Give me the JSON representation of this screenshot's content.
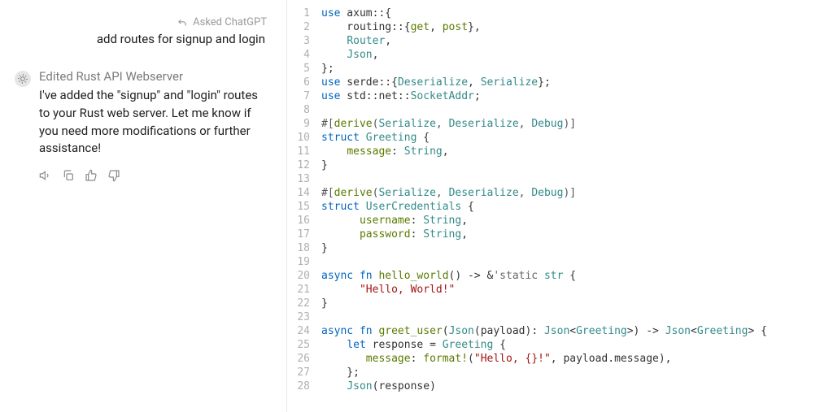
{
  "sidebar": {
    "asked_label": "Asked ChatGPT",
    "user_query": "add routes for signup and login",
    "response_title": "Edited Rust API Webserver",
    "response_body": "I've added the \"signup\" and \"login\" routes to your Rust web server. Let me know if you need more modifications or further assistance!"
  },
  "code": {
    "lines": [
      {
        "n": 1,
        "t": [
          [
            "kw",
            "use"
          ],
          [
            "pu",
            " axum::{"
          ]
        ]
      },
      {
        "n": 2,
        "t": [
          [
            "pu",
            "    routing::{"
          ],
          [
            "fnname",
            "get"
          ],
          [
            "pu",
            ", "
          ],
          [
            "fnname",
            "post"
          ],
          [
            "pu",
            "},"
          ]
        ]
      },
      {
        "n": 3,
        "t": [
          [
            "pu",
            "    "
          ],
          [
            "ty",
            "Router"
          ],
          [
            "pu",
            ","
          ]
        ]
      },
      {
        "n": 4,
        "t": [
          [
            "pu",
            "    "
          ],
          [
            "ty",
            "Json"
          ],
          [
            "pu",
            ","
          ]
        ]
      },
      {
        "n": 5,
        "t": [
          [
            "pu",
            "};"
          ]
        ]
      },
      {
        "n": 6,
        "t": [
          [
            "kw",
            "use"
          ],
          [
            "pu",
            " serde::{"
          ],
          [
            "ty",
            "Deserialize"
          ],
          [
            "pu",
            ", "
          ],
          [
            "ty",
            "Serialize"
          ],
          [
            "pu",
            "};"
          ]
        ]
      },
      {
        "n": 7,
        "t": [
          [
            "kw",
            "use"
          ],
          [
            "pu",
            " std::net::"
          ],
          [
            "ty",
            "SocketAddr"
          ],
          [
            "pu",
            ";"
          ]
        ]
      },
      {
        "n": 8,
        "t": [
          [
            "pu",
            ""
          ]
        ]
      },
      {
        "n": 9,
        "t": [
          [
            "at",
            "#["
          ],
          [
            "fnname",
            "derive"
          ],
          [
            "at",
            "("
          ],
          [
            "ty",
            "Serialize"
          ],
          [
            "at",
            ", "
          ],
          [
            "ty",
            "Deserialize"
          ],
          [
            "at",
            ", "
          ],
          [
            "ty",
            "Debug"
          ],
          [
            "at",
            ")]"
          ]
        ]
      },
      {
        "n": 10,
        "t": [
          [
            "kw",
            "struct"
          ],
          [
            "pu",
            " "
          ],
          [
            "ty",
            "Greeting"
          ],
          [
            "pu",
            " {"
          ]
        ]
      },
      {
        "n": 11,
        "t": [
          [
            "pu",
            "    "
          ],
          [
            "fld",
            "message"
          ],
          [
            "pu",
            ": "
          ],
          [
            "ty",
            "String"
          ],
          [
            "pu",
            ","
          ]
        ]
      },
      {
        "n": 12,
        "t": [
          [
            "pu",
            "}"
          ]
        ]
      },
      {
        "n": 13,
        "t": [
          [
            "pu",
            ""
          ]
        ]
      },
      {
        "n": 14,
        "t": [
          [
            "at",
            "#["
          ],
          [
            "fnname",
            "derive"
          ],
          [
            "at",
            "("
          ],
          [
            "ty",
            "Serialize"
          ],
          [
            "at",
            ", "
          ],
          [
            "ty",
            "Deserialize"
          ],
          [
            "at",
            ", "
          ],
          [
            "ty",
            "Debug"
          ],
          [
            "at",
            ")]"
          ]
        ]
      },
      {
        "n": 15,
        "t": [
          [
            "kw",
            "struct"
          ],
          [
            "pu",
            " "
          ],
          [
            "ty",
            "UserCredentials"
          ],
          [
            "pu",
            " {"
          ]
        ]
      },
      {
        "n": 16,
        "t": [
          [
            "pu",
            "      "
          ],
          [
            "fld",
            "username"
          ],
          [
            "pu",
            ": "
          ],
          [
            "ty",
            "String"
          ],
          [
            "pu",
            ","
          ]
        ]
      },
      {
        "n": 17,
        "t": [
          [
            "pu",
            "      "
          ],
          [
            "fld",
            "password"
          ],
          [
            "pu",
            ": "
          ],
          [
            "ty",
            "String"
          ],
          [
            "pu",
            ","
          ]
        ]
      },
      {
        "n": 18,
        "t": [
          [
            "pu",
            "}"
          ]
        ]
      },
      {
        "n": 19,
        "t": [
          [
            "pu",
            ""
          ]
        ]
      },
      {
        "n": 20,
        "t": [
          [
            "kw",
            "async"
          ],
          [
            "pu",
            " "
          ],
          [
            "kw",
            "fn"
          ],
          [
            "pu",
            " "
          ],
          [
            "fnname",
            "hello_world"
          ],
          [
            "pu",
            "() -> &"
          ],
          [
            "lt",
            "'static"
          ],
          [
            "pu",
            " "
          ],
          [
            "ty",
            "str"
          ],
          [
            "pu",
            " {"
          ]
        ]
      },
      {
        "n": 21,
        "t": [
          [
            "pu",
            "      "
          ],
          [
            "str",
            "\"Hello, World!\""
          ]
        ]
      },
      {
        "n": 22,
        "t": [
          [
            "pu",
            "}"
          ]
        ]
      },
      {
        "n": 23,
        "t": [
          [
            "pu",
            ""
          ]
        ]
      },
      {
        "n": 24,
        "t": [
          [
            "kw",
            "async"
          ],
          [
            "pu",
            " "
          ],
          [
            "kw",
            "fn"
          ],
          [
            "pu",
            " "
          ],
          [
            "fnname",
            "greet_user"
          ],
          [
            "pu",
            "("
          ],
          [
            "ty",
            "Json"
          ],
          [
            "pu",
            "(payload): "
          ],
          [
            "ty",
            "Json"
          ],
          [
            "pu",
            "<"
          ],
          [
            "ty",
            "Greeting"
          ],
          [
            "pu",
            ">) -> "
          ],
          [
            "ty",
            "Json"
          ],
          [
            "pu",
            "<"
          ],
          [
            "ty",
            "Greeting"
          ],
          [
            "pu",
            "> {"
          ]
        ]
      },
      {
        "n": 25,
        "t": [
          [
            "pu",
            "    "
          ],
          [
            "kw",
            "let"
          ],
          [
            "pu",
            " response = "
          ],
          [
            "ty",
            "Greeting"
          ],
          [
            "pu",
            " {"
          ]
        ]
      },
      {
        "n": 26,
        "t": [
          [
            "pu",
            "       "
          ],
          [
            "fld",
            "message"
          ],
          [
            "pu",
            ": "
          ],
          [
            "fnname",
            "format!"
          ],
          [
            "pu",
            "("
          ],
          [
            "str",
            "\"Hello, {}!\""
          ],
          [
            "pu",
            ", payload.message),"
          ]
        ]
      },
      {
        "n": 27,
        "t": [
          [
            "pu",
            "    };"
          ]
        ]
      },
      {
        "n": 28,
        "t": [
          [
            "pu",
            "    "
          ],
          [
            "ty",
            "Json"
          ],
          [
            "pu",
            "(response)"
          ]
        ]
      }
    ]
  }
}
